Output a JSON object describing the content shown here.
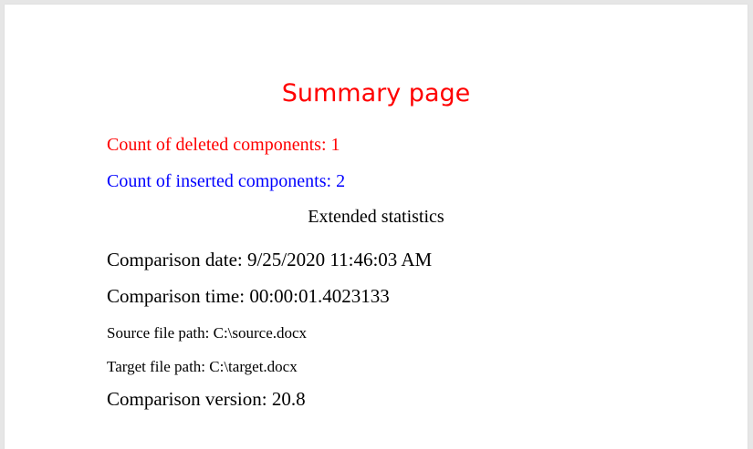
{
  "document": {
    "title": "Summary page",
    "deleted_count": "Count of deleted components: 1",
    "inserted_count": "Count of inserted components: 2",
    "extended_heading": "Extended statistics",
    "comparison_date": "Comparison date: 9/25/2020 11:46:03 AM",
    "comparison_time": "Comparison time: 00:00:01.4023133",
    "source_path": "Source file path: C:\\source.docx",
    "target_path": "Target file path: C:\\target.docx",
    "comparison_version": "Comparison version: 20.8"
  },
  "colors": {
    "title": "#ff0000",
    "deleted": "#ff0000",
    "inserted": "#0000ff",
    "text": "#000000",
    "page": "#ffffff",
    "canvas": "#e6e6e6"
  }
}
